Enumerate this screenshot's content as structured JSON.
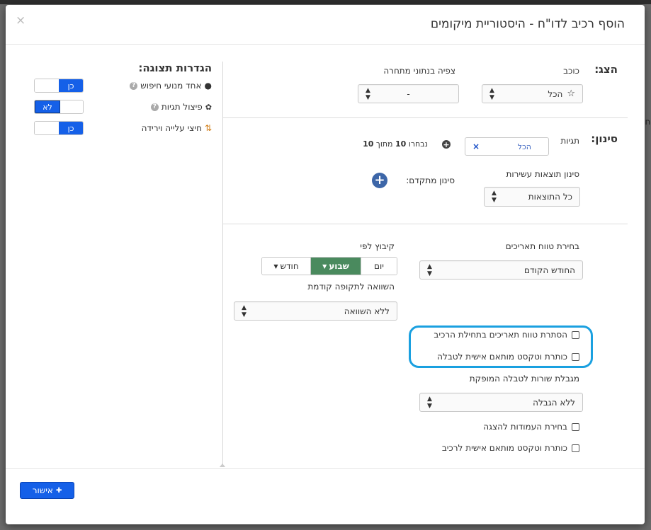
{
  "modal": {
    "title": "הוסף רכיב לדו\"ח - היסטוריית מיקומים",
    "close": "×",
    "confirm_label": "אישור"
  },
  "behind_text": "\"ח",
  "display": {
    "section_title": "הצג:",
    "planet_label": "כוכב",
    "planet_value": "הכל",
    "competition_label": "צפיה בנתוני מתחרה",
    "competition_value": "-"
  },
  "filter": {
    "section_title": "סינון:",
    "tags_label": "תגיות",
    "tags_chip": "הכל",
    "tags_count_prefix": "נבחרו",
    "tags_count_selected": "10",
    "tags_count_mid": "מתוך",
    "tags_count_total": "10",
    "decile_label": "סינון תוצאות עשירות",
    "decile_value": "כל התוצאות",
    "advanced_label": "סינון מתקדם:"
  },
  "dates": {
    "range_label": "בחירת טווח תאריכים",
    "range_value": "החודש הקודם",
    "group_label": "קיבוץ לפי",
    "group_options": [
      "יום",
      "שבוע",
      "חודש"
    ],
    "group_active": "שבוע",
    "compare_label": "השוואה לתקופה קודמת",
    "compare_value": "ללא השוואה"
  },
  "options": {
    "hide_range": "הסתרת טווח תאריכים בתחילת הרכיב",
    "custom_table_title": "כותרת וטקסט מותאם אישית לטבלה",
    "row_limit_label": "מגבלת שורות לטבלה המופקת",
    "row_limit_value": "ללא הגבלה",
    "choose_columns": "בחירת העמודות להצגה",
    "custom_component_title": "כותרת וטקסט מותאם אישית לרכיב"
  },
  "view_settings": {
    "title": "הגדרות תצוגה:",
    "items": [
      {
        "label": "אחד מנועי חיפוש",
        "toggle": "כן",
        "state": "on"
      },
      {
        "label": "פיצול תגיות",
        "toggle": "לא",
        "state": "off"
      },
      {
        "label": "חיצי עלייה וירידה",
        "toggle": "כן",
        "state": "on"
      }
    ]
  },
  "colors": {
    "primary": "#1560e8",
    "active_segment": "#4a8a5e",
    "highlight": "#1aa0e0"
  }
}
